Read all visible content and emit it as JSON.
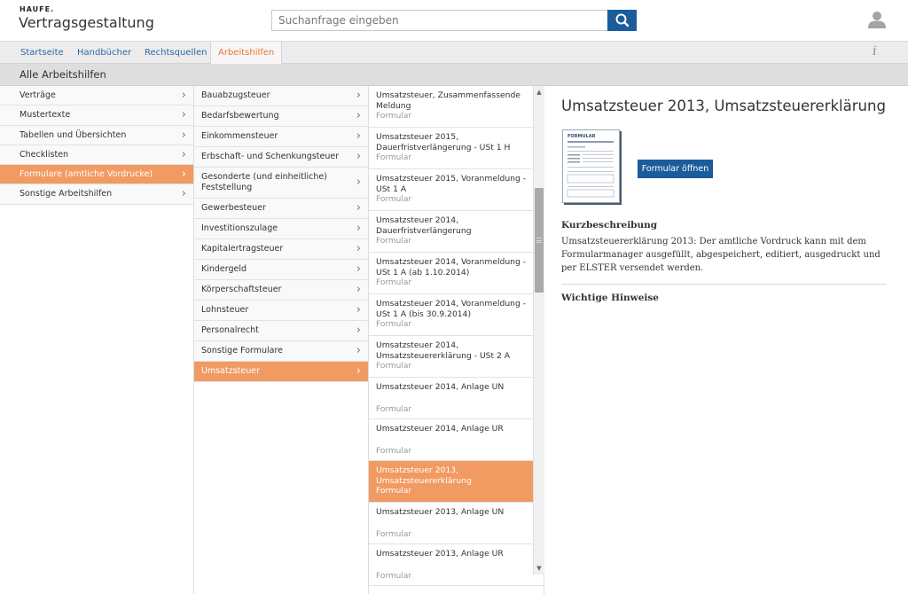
{
  "header": {
    "brand_top": "HAUFE.",
    "brand_name": "Vertragsgestaltung",
    "search_placeholder": "Suchanfrage eingeben"
  },
  "nav": {
    "tabs": [
      {
        "label": "Startseite",
        "active": false
      },
      {
        "label": "Handbücher",
        "active": false
      },
      {
        "label": "Rechtsquellen",
        "active": false
      },
      {
        "label": "Arbeitshilfen",
        "active": true
      }
    ],
    "info_glyph": "i"
  },
  "section": {
    "title": "Alle Arbeitshilfen"
  },
  "categories": [
    {
      "label": "Verträge"
    },
    {
      "label": "Mustertexte"
    },
    {
      "label": "Tabellen und Übersichten"
    },
    {
      "label": "Checklisten"
    },
    {
      "label": "Formulare (amtliche Vordrucke)",
      "active": true
    },
    {
      "label": "Sonstige Arbeitshilfen"
    }
  ],
  "subcategories": [
    {
      "label": "Bauabzugsteuer"
    },
    {
      "label": "Bedarfsbewertung"
    },
    {
      "label": "Einkommensteuer"
    },
    {
      "label": "Erbschaft- und Schenkungsteuer"
    },
    {
      "label": "Gesonderte (und einheitliche) Feststellung"
    },
    {
      "label": "Gewerbesteuer"
    },
    {
      "label": "Investitionszulage"
    },
    {
      "label": "Kapitalertragsteuer"
    },
    {
      "label": "Kindergeld"
    },
    {
      "label": "Körperschaftsteuer"
    },
    {
      "label": "Lohnsteuer"
    },
    {
      "label": "Personalrecht"
    },
    {
      "label": "Sonstige Formulare"
    },
    {
      "label": "Umsatzsteuer",
      "active": true
    }
  ],
  "documents": [
    {
      "title": "Umsatzsteuer, Zusammenfassende Meldung",
      "type": "Formular"
    },
    {
      "title": "Umsatzsteuer 2015, Dauerfristverlängerung - USt 1 H",
      "type": "Formular"
    },
    {
      "title": "Umsatzsteuer 2015, Voranmeldung - USt 1 A",
      "type": "Formular"
    },
    {
      "title": "Umsatzsteuer 2014, Dauerfristverlängerung",
      "type": "Formular"
    },
    {
      "title": "Umsatzsteuer 2014, Voranmeldung - USt 1 A (ab 1.10.2014)",
      "type": "Formular"
    },
    {
      "title": "Umsatzsteuer 2014, Voranmeldung - USt 1 A (bis 30.9.2014)",
      "type": "Formular"
    },
    {
      "title": "Umsatzsteuer 2014, Umsatzsteuererklärung - USt 2 A",
      "type": "Formular"
    },
    {
      "title": "Umsatzsteuer 2014, Anlage UN",
      "type": "Formular"
    },
    {
      "title": "Umsatzsteuer 2014, Anlage UR",
      "type": "Formular"
    },
    {
      "title": "Umsatzsteuer 2013, Umsatzsteuererklärung",
      "type": "Formular",
      "active": true
    },
    {
      "title": "Umsatzsteuer 2013, Anlage UN",
      "type": "Formular"
    },
    {
      "title": "Umsatzsteuer 2013, Anlage UR",
      "type": "Formular"
    }
  ],
  "detail": {
    "title": "Umsatzsteuer 2013, Umsatzsteuererklärung",
    "thumbnail_label": "FORMULAR",
    "open_button": "Formular öffnen",
    "summary_heading": "Kurzbeschreibung",
    "summary_text": "Umsatzsteuererklärung 2013: Der amtliche Vordruck kann mit dem Formularmanager ausgefüllt, abgespeichert, editiert, ausgedruckt und per ELSTER versendet werden.",
    "notes_heading": "Wichtige Hinweise"
  },
  "colors": {
    "accent": "#f19a61",
    "accent_text": "#e8772e",
    "primary": "#1b5c9c",
    "link": "#2a6aa8"
  }
}
